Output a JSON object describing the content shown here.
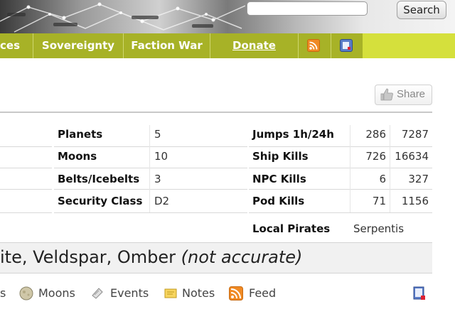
{
  "search": {
    "value": "",
    "button_label": "Search"
  },
  "nav": {
    "items": [
      {
        "label": "ces"
      },
      {
        "label": "Sovereignty"
      },
      {
        "label": "Faction War"
      },
      {
        "label": "Donate"
      }
    ],
    "icons": [
      "rss-icon",
      "book-icon"
    ]
  },
  "share": {
    "label": "Share",
    "icon": "thumbs-up-icon"
  },
  "stats": {
    "planets_label": "Planets",
    "planets_value": "5",
    "moons_label": "Moons",
    "moons_value": "10",
    "belts_label": "Belts/Icebelts",
    "belts_value": "3",
    "security_label": "Security Class",
    "security_value": "D2",
    "jumps_label": "Jumps 1h/24h",
    "jumps_1h": "286",
    "jumps_24h": "7287",
    "ship_kills_label": "Ship Kills",
    "ship_kills_1h": "726",
    "ship_kills_24h": "16634",
    "npc_kills_label": "NPC Kills",
    "npc_kills_1h": "6",
    "npc_kills_24h": "327",
    "pod_kills_label": "Pod Kills",
    "pod_kills_1h": "71",
    "pod_kills_24h": "1156",
    "pirates_label": "Local Pirates",
    "pirates_value": "Serpentis"
  },
  "ore": {
    "text": "ite, Veldspar, Omber",
    "note": "(not accurate)"
  },
  "bottom_links": {
    "first": "s",
    "moons": "Moons",
    "events": "Events",
    "notes": "Notes",
    "feed": "Feed"
  },
  "colors": {
    "nav_bg": "#a7b227",
    "nav_tail": "#d5e03c",
    "nav_text": "#ffffff"
  }
}
